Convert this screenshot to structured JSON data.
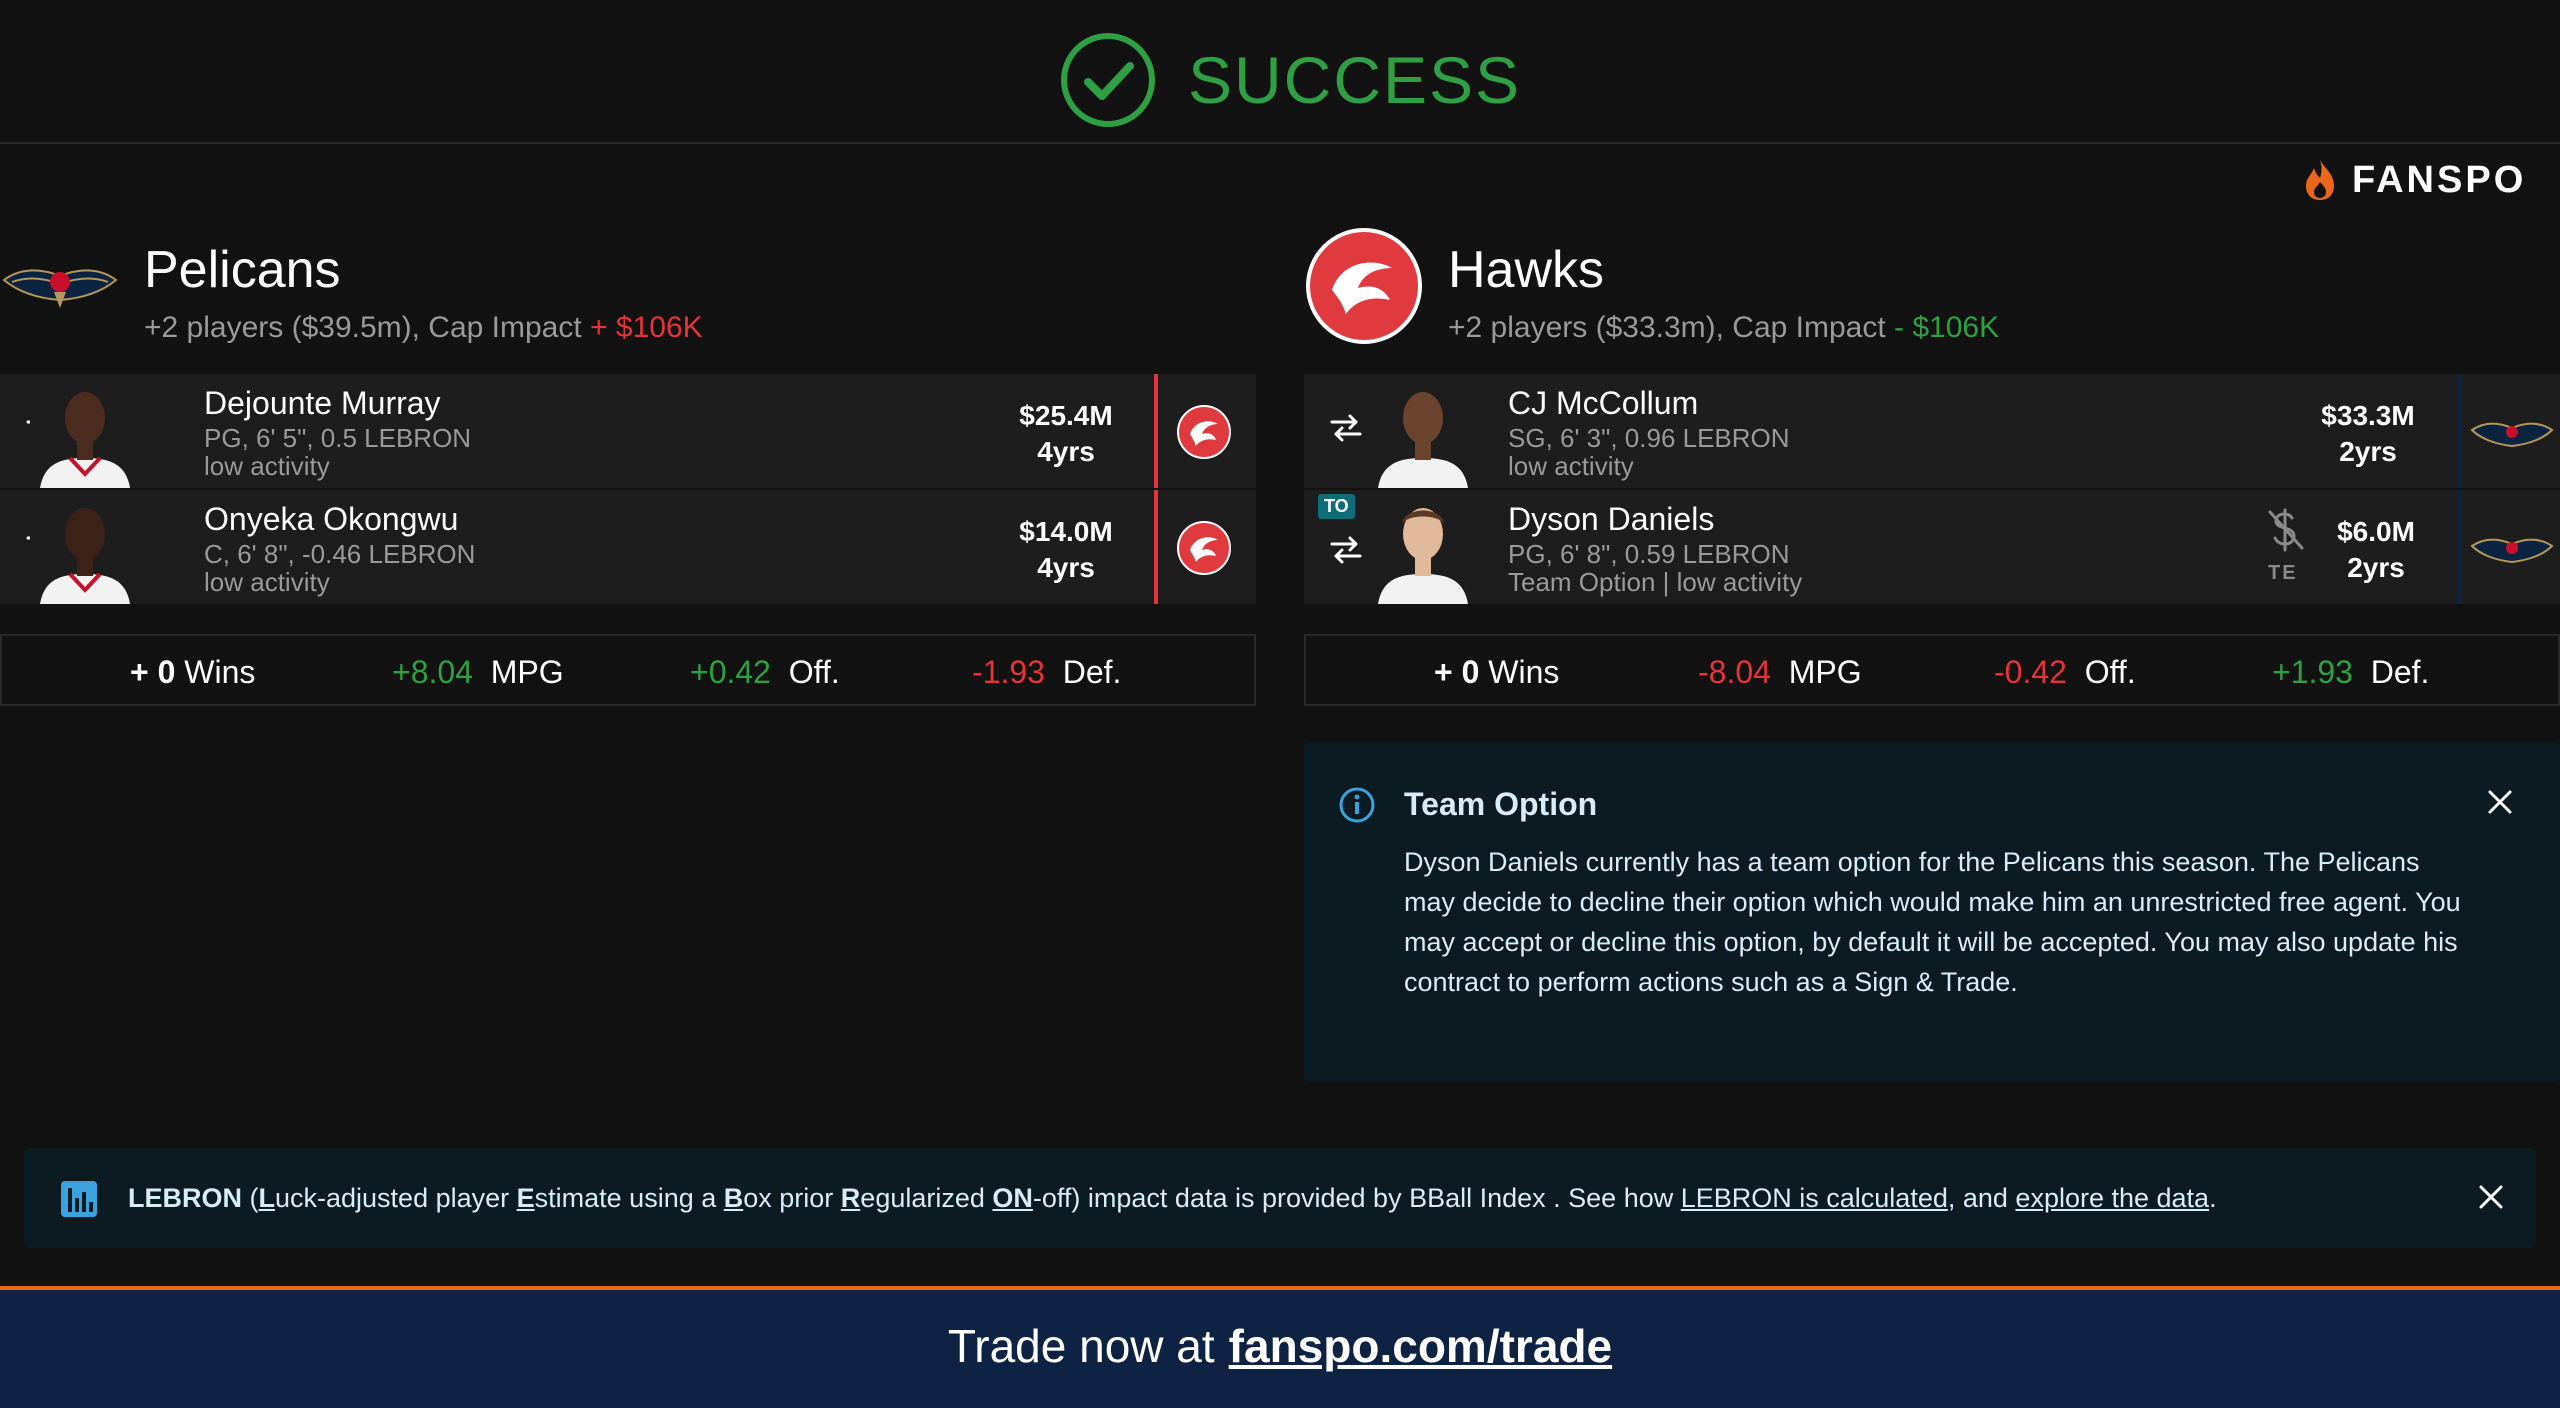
{
  "header": {
    "status": "SUCCESS",
    "brand": "FANSPO"
  },
  "teams": [
    {
      "name": "Pelicans",
      "summary_prefix": "+2 players ($39.5m), Cap Impact ",
      "cap_impact": "+ $106K",
      "players": [
        {
          "name": "Dejounte Murray",
          "info": "PG, 6' 5\", 0.5 LEBRON",
          "status": "low activity",
          "salary": "$25.4M",
          "years": "4yrs"
        },
        {
          "name": "Onyeka Okongwu",
          "info": "C, 6' 8\", -0.46 LEBRON",
          "status": "low activity",
          "salary": "$14.0M",
          "years": "4yrs"
        }
      ],
      "stats": {
        "wins": "+ 0",
        "wins_label": "Wins",
        "mpg": "+8.04",
        "mpg_label": "MPG",
        "off": "+0.42",
        "off_label": "Off.",
        "def": "-1.93",
        "def_label": "Def."
      }
    },
    {
      "name": "Hawks",
      "summary_prefix": "+2 players ($33.3m), Cap Impact ",
      "cap_impact": "- $106K",
      "players": [
        {
          "name": "CJ McCollum",
          "info": "SG, 6' 3\", 0.96 LEBRON",
          "status": "low activity",
          "salary": "$33.3M",
          "years": "2yrs"
        },
        {
          "name": "Dyson Daniels",
          "info": "PG, 6' 8\", 0.59 LEBRON",
          "status": "Team Option | low activity",
          "salary": "$6.0M",
          "years": "2yrs",
          "badge": "TO",
          "te_label": "TE"
        }
      ],
      "stats": {
        "wins": "+ 0",
        "wins_label": "Wins",
        "mpg": "-8.04",
        "mpg_label": "MPG",
        "off": "-0.42",
        "off_label": "Off.",
        "def": "+1.93",
        "def_label": "Def."
      }
    }
  ],
  "team_option": {
    "title": "Team Option",
    "body": "Dyson Daniels currently has a team option for the Pelicans this season. The Pelicans may decide to decline their option which would make him an unrestricted free agent. You may accept or decline this option, by default it will be accepted. You may also update his contract to perform actions such as a Sign & Trade."
  },
  "lebron_banner": {
    "key": "LEBRON",
    "p1": " (",
    "L": "L",
    "p2": "uck-adjusted player ",
    "E": "E",
    "p3": "stimate using a ",
    "B": "B",
    "p4": "ox prior ",
    "R": "R",
    "p5": "egularized ",
    "ON": "ON",
    "p6": "-off) impact data is provided by BBall Index . See how ",
    "link1": "LEBRON is calculated",
    "p7": ", and ",
    "link2": "explore the data",
    "p8": "."
  },
  "footer": {
    "prefix": "Trade now at",
    "url": "fanspo.com/trade"
  },
  "colors": {
    "success": "#2ea043",
    "negative": "#e5323b",
    "hawks_red": "#e03a3e",
    "pelicans_navy": "#0c2340",
    "footer_orange": "#e8671a"
  }
}
